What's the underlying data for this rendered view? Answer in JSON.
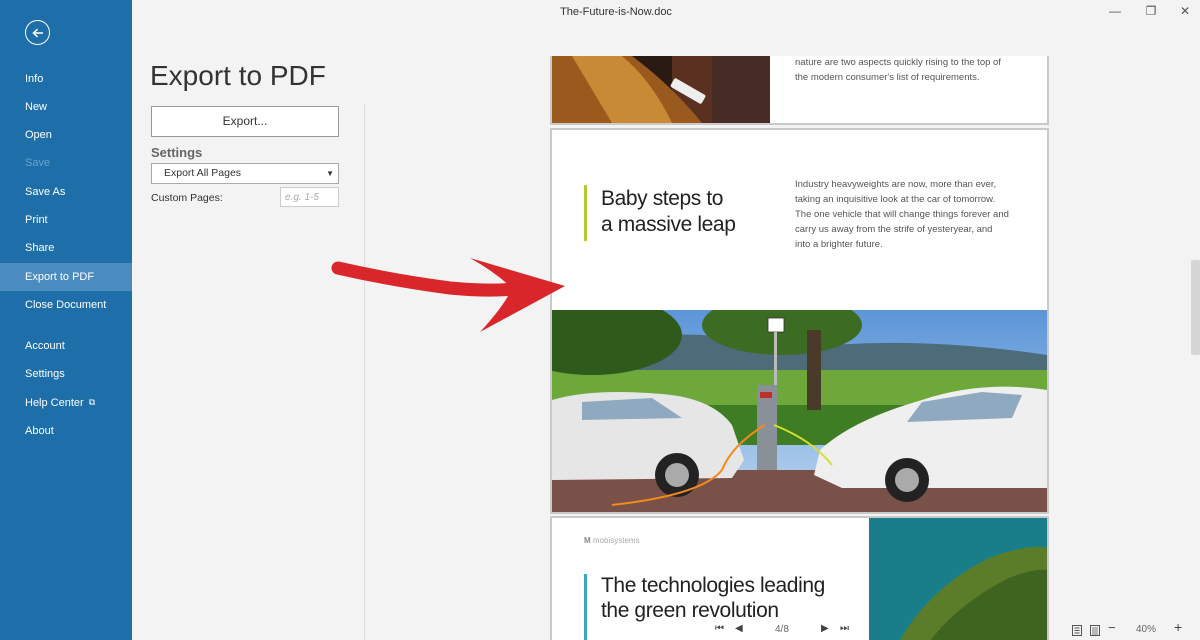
{
  "window": {
    "title": "The-Future-is-Now.doc",
    "minimize_symbol": "—",
    "restore_symbol": "❐",
    "close_symbol": "✕"
  },
  "sidebar": {
    "items": [
      {
        "label": "Info"
      },
      {
        "label": "New"
      },
      {
        "label": "Open"
      },
      {
        "label": "Save"
      },
      {
        "label": "Save As"
      },
      {
        "label": "Print"
      },
      {
        "label": "Share"
      },
      {
        "label": "Export to PDF"
      },
      {
        "label": "Close Document"
      },
      {
        "label": "Account"
      },
      {
        "label": "Settings"
      },
      {
        "label": "Help Center"
      },
      {
        "label": "About"
      }
    ],
    "active": "Export to PDF",
    "disabled": [
      "Save"
    ],
    "colors": {
      "background": "#1d6ea9",
      "active": "#4a8cc0",
      "disabled_text": "#6aa3cd"
    }
  },
  "export_panel": {
    "title": "Export to PDF",
    "export_button": "Export...",
    "settings_label": "Settings",
    "pages_select": {
      "value": "Export All Pages"
    },
    "custom_pages_label": "Custom Pages:",
    "custom_pages_placeholder": "e.g. 1-5"
  },
  "document": {
    "page_top": {
      "text_lines": [
        "nature are two aspects quickly rising to the top of",
        "the modern consumer's list of requirements."
      ]
    },
    "page_middle": {
      "headline_lines": [
        "Baby steps to",
        "a massive leap"
      ],
      "accent_color": "#b3cb2f",
      "body_lines": [
        "Industry heavyweights are now, more than ever,",
        "taking an inquisitive look at the car of tomorrow.",
        "The one vehicle that will change things forever and",
        "carry us away from the strife of yesteryear, and",
        "into a brighter future."
      ]
    },
    "page_bottom": {
      "logo_text": "mobisystems",
      "headline_lines": [
        "The technologies leading",
        "the green revolution"
      ],
      "accent_color": "#3aa6b9"
    }
  },
  "status_bar": {
    "page_indicator": "4/8",
    "zoom": "40%",
    "zoom_out_symbol": "−",
    "zoom_in_symbol": "+"
  }
}
